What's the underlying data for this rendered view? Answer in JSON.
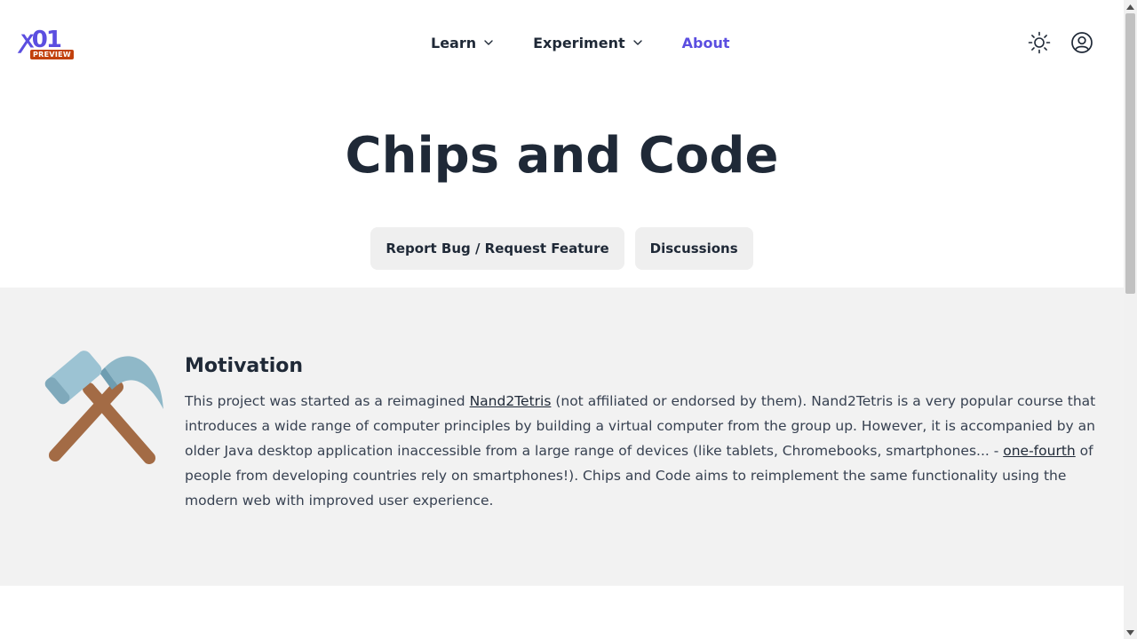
{
  "header": {
    "logo": {
      "glyph": "ꭗ01",
      "badge": "PREVIEW"
    },
    "nav": {
      "learn": "Learn",
      "experiment": "Experiment",
      "about": "About"
    },
    "icons": {
      "theme": "sun-icon",
      "account": "user-circle-icon"
    },
    "accent_color": "#5b4ee0"
  },
  "hero": {
    "title": "Chips and Code",
    "report_button": "Report Bug / Request Feature",
    "discussions_button": "Discussions"
  },
  "motivation": {
    "icon": "hammer-and-pick-icon",
    "title": "Motivation",
    "text_1": "This project was started as a reimagined ",
    "link_1": "Nand2Tetris",
    "text_2": " (not affiliated or endorsed by them). Nand2Tetris is a very popular course that introduces a wide range of computer principles by building a virtual computer from the group up. However, it is accompanied by an older Java desktop application inaccessible from a large range of devices (like tablets, Chromebooks, smartphones... - ",
    "link_2": "one-fourth",
    "text_3": " of people from developing countries rely on smartphones!). Chips and Code aims to reimplement the same functionality using the modern web with improved user experience."
  }
}
